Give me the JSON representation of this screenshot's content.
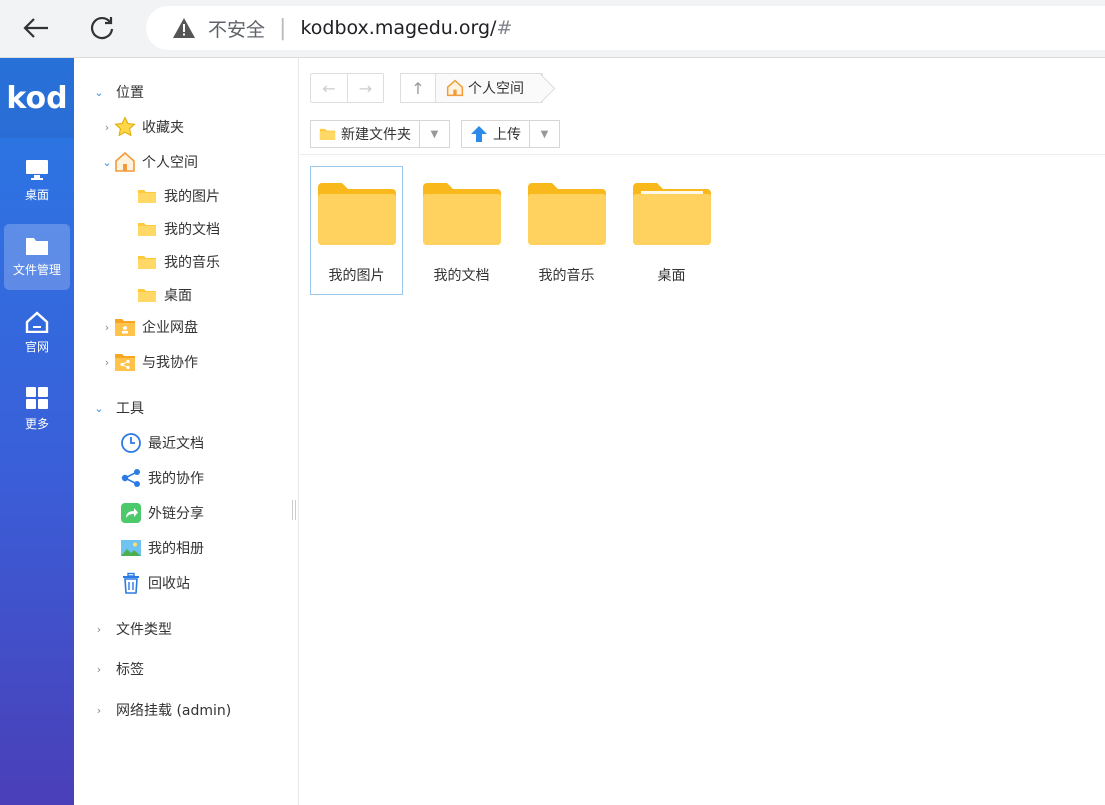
{
  "browser": {
    "security_label": "不安全",
    "url_host": "kodbox.magedu.org/",
    "url_hash": "#"
  },
  "rail": {
    "logo": "kod",
    "items": [
      {
        "label": "桌面",
        "icon": "monitor-icon"
      },
      {
        "label": "文件管理",
        "icon": "folder-icon",
        "active": true
      },
      {
        "label": "官网",
        "icon": "home-icon"
      },
      {
        "label": "更多",
        "icon": "grid-icon"
      }
    ]
  },
  "tree": {
    "section_location": "位置",
    "favorites": "收藏夹",
    "personal_space": "个人空间",
    "personal_children": [
      "我的图片",
      "我的文档",
      "我的音乐",
      "桌面"
    ],
    "enterprise_disk": "企业网盘",
    "collab_with_me": "与我协作",
    "section_tools": "工具",
    "tools": [
      "最近文档",
      "我的协作",
      "外链分享",
      "我的相册",
      "回收站"
    ],
    "file_types": "文件类型",
    "tags": "标签",
    "network_mount": "网络挂载 (admin)"
  },
  "main": {
    "breadcrumb": "个人空间",
    "new_folder_label": "新建文件夹",
    "upload_label": "上传",
    "files": [
      "我的图片",
      "我的文档",
      "我的音乐",
      "桌面"
    ]
  },
  "colors": {
    "accent": "#2a79e6",
    "folder": "#ffc93c",
    "selection": "#9cc8ef"
  }
}
